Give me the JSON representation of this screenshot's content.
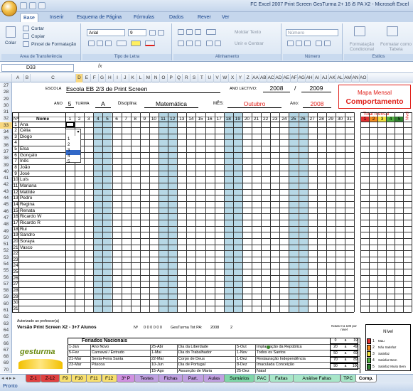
{
  "window": {
    "title": "FC Excel 2007 Print Screen GesTurma 2+ 16 i5 PA X2 - Microsoft Excel"
  },
  "ribbon_tabs": [
    "Base",
    "Inserir",
    "Esquema de Página",
    "Fórmulas",
    "Dados",
    "Rever",
    "Ver"
  ],
  "ribbon": {
    "paste": "Colar",
    "cut": "Cortar",
    "copy": "Copiar",
    "format_painter": "Pincel de Formatação",
    "clipboard": "Área de Transferência",
    "font_name": "Arial",
    "font_size": "9",
    "font_group": "Tipo de Letra",
    "wrap": "Moldar Texto",
    "merge": "Unir e Centrar",
    "align_group": "Alinhamento",
    "number_format": "Número",
    "number_group": "Número",
    "cond_format": "Formatação Condicional",
    "format_table": "Formatar como Tabela",
    "styles_group": "Estilos"
  },
  "namebox": "D33",
  "fx": "fx",
  "columns": [
    "A",
    "B",
    "C",
    "D",
    "E",
    "F",
    "G",
    "H",
    "I",
    "J",
    "K",
    "L",
    "M",
    "N",
    "O",
    "P",
    "Q",
    "R",
    "S",
    "T",
    "U",
    "V",
    "W",
    "X",
    "Y",
    "Z",
    "AA",
    "AB",
    "AC",
    "AD",
    "AE",
    "AF",
    "AG",
    "AH",
    "AI",
    "AJ",
    "AK",
    "AL",
    "AM",
    "AN",
    "AO"
  ],
  "rows": [
    "27",
    "28",
    "29",
    "30",
    "31",
    "32",
    "33",
    "34",
    "35",
    "36",
    "37",
    "38",
    "39",
    "40",
    "41",
    "42",
    "43",
    "44",
    "45",
    "46",
    "47",
    "48",
    "49",
    "50",
    "51",
    "52",
    "53",
    "54",
    "55",
    "56",
    "57",
    "58",
    "59",
    "60",
    "61",
    "62",
    "63",
    "64",
    "65",
    "66",
    "67",
    "68",
    "69",
    "70"
  ],
  "header": {
    "escola_label": "ESCOLA",
    "escola": "Escola EB 2/3 de Print Screen",
    "ano_lectivo_label": "ANO LECTIVO:",
    "ano_lectivo_1": "2008",
    "slash": "/",
    "ano_lectivo_2": "2009",
    "ano_label": "ANO",
    "ano": "5",
    "turma_label": "TURMA",
    "turma": "A",
    "disciplina_label": "Disciplina:",
    "disciplina": "Matemática",
    "mes_label": "MÊS:",
    "mes": "Outubro",
    "ano2_label": "Ano:",
    "ano2": "2008",
    "mapa_label": "Mapa Mensal",
    "comportamento": "Comportamento"
  },
  "table": {
    "num_label": "Nº",
    "nome_label": "Nome",
    "total_label": "Total mensal",
    "nivel_label": "Nível"
  },
  "days": [
    "1",
    "2",
    "3",
    "4",
    "5",
    "6",
    "7",
    "8",
    "9",
    "10",
    "11",
    "12",
    "13",
    "14",
    "15",
    "16",
    "17",
    "18",
    "19",
    "20",
    "21",
    "22",
    "23",
    "24",
    "25",
    "26",
    "27",
    "28",
    "29",
    "30",
    "31"
  ],
  "levels": [
    "1",
    "2",
    "3",
    "4",
    "5"
  ],
  "level_colors": [
    "#e03030",
    "#f08a20",
    "#f0e040",
    "#50b040",
    "#308030"
  ],
  "dropdown_items": [
    "1",
    "2",
    "3",
    "4",
    "5"
  ],
  "students": [
    "Ana",
    "Célia",
    "Diogo",
    "",
    "Elsa",
    "Gonçalo",
    "Inês",
    "João",
    "José",
    "Luís",
    "Mariana",
    "Matilde",
    "Pedro",
    "Regina",
    "Renata",
    "Ricardo W",
    "Ricardo R",
    "Rui",
    "Sandro",
    "Soraya",
    "Vasco",
    "",
    "",
    "",
    "",
    "",
    "",
    "",
    "",
    "",
    ""
  ],
  "footer": {
    "autorizado": "Autorizado ao professor(a)",
    "versao": "Versão Print Screen X2 - 3+7 Alunos",
    "serial_label": "Nº",
    "serial": "0 0 0 0 0 0",
    "gesturma_label": "GesTurma Tot PA:",
    "gesturma_val": "2008",
    "gesturma_n": "2",
    "feriados_title": "Feriados Nacionais",
    "feriados": [
      [
        "1-Jan",
        "Ano Novo",
        "25-Abr",
        "Dia da Liberdade",
        "5-Out",
        "Implantação da República"
      ],
      [
        "5-Fev",
        "Carnaval / Entrudo",
        "1-Mai",
        "Dia do Trabalhador",
        "1-Nov",
        "Todos os Santos"
      ],
      [
        "21-Mar",
        "Sexta-Feira Santa",
        "22-Mai",
        "Corpo de Deus",
        "1-Dez",
        "Restauração Independência"
      ],
      [
        "23-Mar",
        "Páscoa",
        "10-Jun",
        "Dia de Portugal",
        "8-Dez",
        "Imaculada Conceição"
      ],
      [
        "",
        "",
        "15-Ago",
        "Assunção de Maria",
        "25-Dez",
        "Natal"
      ]
    ],
    "escala_title": "Nível",
    "escala": [
      [
        "1",
        "Mau"
      ],
      [
        "2",
        "Não Satisfaz"
      ],
      [
        "3",
        "Satisfaz"
      ],
      [
        "4",
        "Satisfaz Bem"
      ],
      [
        "5",
        "Satisfaz Muito Bem"
      ]
    ],
    "notas_title": "Notas 0 a 100 por nível",
    "notas": [
      [
        "0",
        "a",
        "19"
      ],
      [
        "20",
        "a",
        "49"
      ],
      [
        "50",
        "a",
        "69"
      ],
      [
        "70",
        "a",
        "89"
      ],
      [
        "90",
        "a",
        "100"
      ]
    ],
    "logo": "gesturma"
  },
  "sheet_tabs": [
    "Z-1",
    "Z-12",
    "F9",
    "F10",
    "F11",
    "F12",
    "3º P",
    "Testes",
    "Fichas",
    "Part.",
    "Aulas",
    "Sumários",
    "PAC",
    "Faltas",
    "Análise Faltas",
    "TPC",
    "Comp."
  ],
  "status": "Pronto"
}
